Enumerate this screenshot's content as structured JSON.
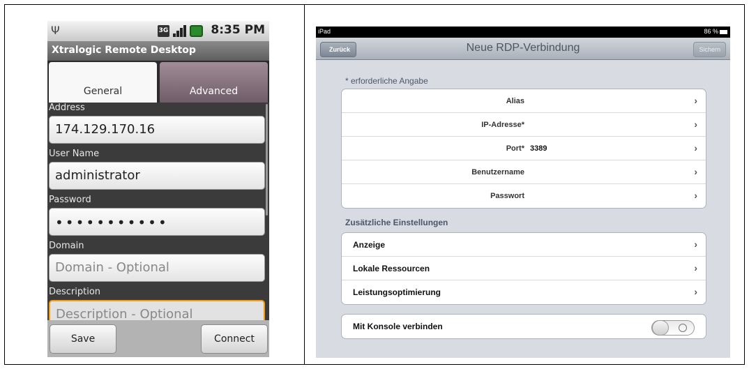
{
  "android": {
    "status": {
      "time": "8:35 PM",
      "network_badge": "3G"
    },
    "title": "Xtralogic Remote Desktop",
    "tabs": [
      {
        "label": "General",
        "selected": true
      },
      {
        "label": "Advanced",
        "selected": false
      }
    ],
    "fields": {
      "address": {
        "label": "Address",
        "value": "174.129.170.16"
      },
      "user_name": {
        "label": "User Name",
        "value": "administrator"
      },
      "password": {
        "label": "Password",
        "value": "•••••••••••"
      },
      "domain": {
        "label": "Domain",
        "placeholder": "Domain - Optional"
      },
      "description": {
        "label": "Description",
        "placeholder": "Description - Optional"
      }
    },
    "buttons": {
      "save": "Save",
      "connect": "Connect"
    }
  },
  "ipad": {
    "status": {
      "carrier": "iPad",
      "battery": "86 %"
    },
    "nav": {
      "back": "Zurück",
      "title": "Neue RDP-Verbindung",
      "save": "Sichern"
    },
    "required_header": "* erforderliche Angabe",
    "required_rows": [
      {
        "label": "Alias",
        "value": ""
      },
      {
        "label": "IP-Adresse*",
        "value": ""
      },
      {
        "label": "Port*",
        "value": "3389"
      },
      {
        "label": "Benutzername",
        "value": ""
      },
      {
        "label": "Passwort",
        "value": ""
      }
    ],
    "extra_header": "Zusätzliche Einstellungen",
    "extra_rows": [
      {
        "label": "Anzeige"
      },
      {
        "label": "Lokale Ressourcen"
      },
      {
        "label": "Leistungsoptimierung"
      }
    ],
    "console": {
      "label": "Mit Konsole verbinden",
      "enabled": false
    }
  }
}
